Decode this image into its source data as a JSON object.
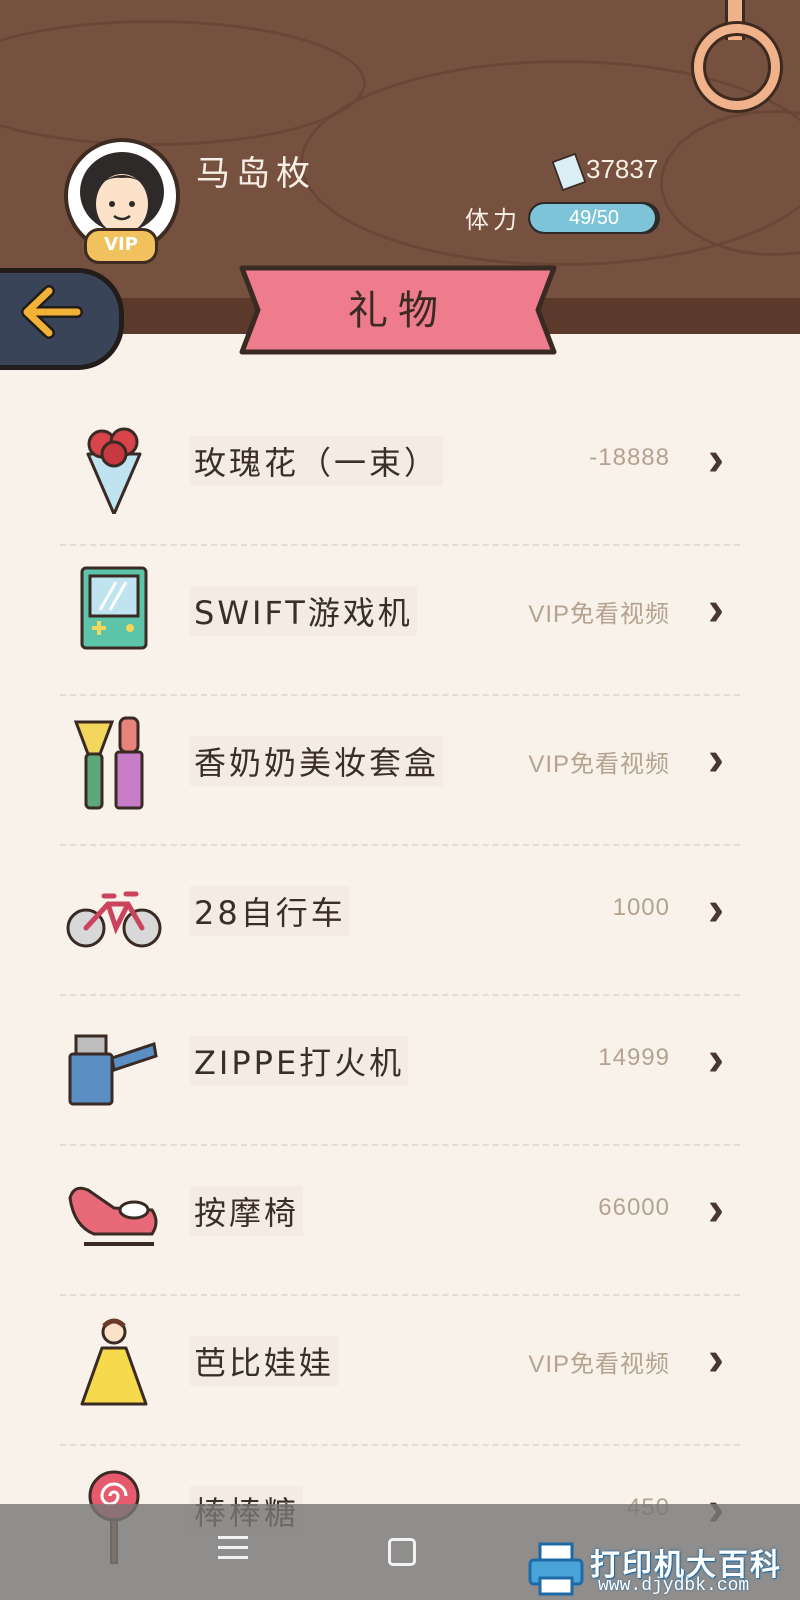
{
  "player": {
    "name": "马岛枚",
    "vip_label": "VIP",
    "money": "37837",
    "stamina_label": "体力",
    "stamina_text": "49/50",
    "stamina_fraction": 0.98
  },
  "page": {
    "title": "礼物"
  },
  "gifts": [
    {
      "name": "玫瑰花（一束）",
      "price": "-18888",
      "icon": "rose-bouquet-icon"
    },
    {
      "name": "SWIFT游戏机",
      "price": "VIP免看视频",
      "icon": "game-console-icon"
    },
    {
      "name": "香奶奶美妆套盒",
      "price": "VIP免看视频",
      "icon": "makeup-kit-icon"
    },
    {
      "name": "28自行车",
      "price": "1000",
      "icon": "bicycle-icon"
    },
    {
      "name": "ZIPPE打火机",
      "price": "14999",
      "icon": "lighter-icon"
    },
    {
      "name": "按摩椅",
      "price": "66000",
      "icon": "massage-chair-icon"
    },
    {
      "name": "芭比娃娃",
      "price": "VIP免看视频",
      "icon": "barbie-doll-icon"
    },
    {
      "name": "棒棒糖",
      "price": "450",
      "icon": "lollipop-icon"
    }
  ],
  "chevron": "›",
  "watermark": {
    "main": "打印机大百科",
    "sub": "www.djydbk.com"
  },
  "colors": {
    "header": "#77513f",
    "ribbon": "#ee7c8c",
    "background": "#f8f2ea",
    "accent": "#f2b237"
  }
}
